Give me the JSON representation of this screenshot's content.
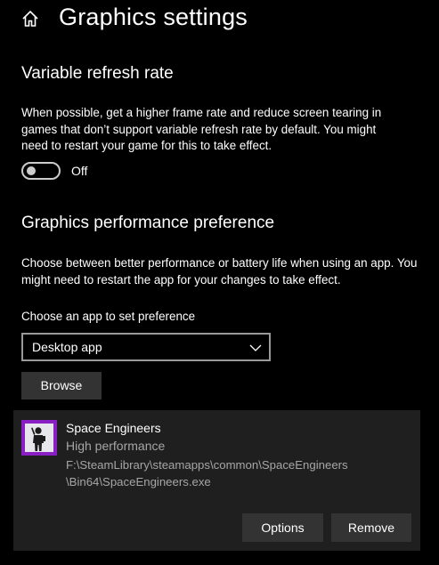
{
  "header": {
    "home_icon": "home-icon",
    "title": "Graphics settings"
  },
  "variable_refresh": {
    "title": "Variable refresh rate",
    "description": "When possible, get a higher frame rate and reduce screen tearing in games that don’t support variable refresh rate by default. You might need to restart your game for this to take effect.",
    "toggle_on": false,
    "toggle_label": "Off"
  },
  "performance": {
    "title": "Graphics performance preference",
    "description": "Choose between better performance or battery life when using an app. You might need to restart the app for your changes to take effect.",
    "choose_label": "Choose an app to set preference",
    "dropdown_value": "Desktop app",
    "dropdown_icon": "chevron-down-icon",
    "browse_label": "Browse"
  },
  "app_entry": {
    "name": "Space Engineers",
    "preference": "High performance",
    "path_line1": "F:\\SteamLibrary\\steamapps\\common\\SpaceEngineers",
    "path_line2": "\\Bin64\\SpaceEngineers.exe",
    "options_label": "Options",
    "remove_label": "Remove",
    "icon": "space-engineers-app-icon",
    "icon_border_color": "#8a1fc4"
  },
  "colors": {
    "background": "#000000",
    "card": "#1f1f1f",
    "button": "#333333",
    "secondary_text": "#a6a6a6"
  }
}
